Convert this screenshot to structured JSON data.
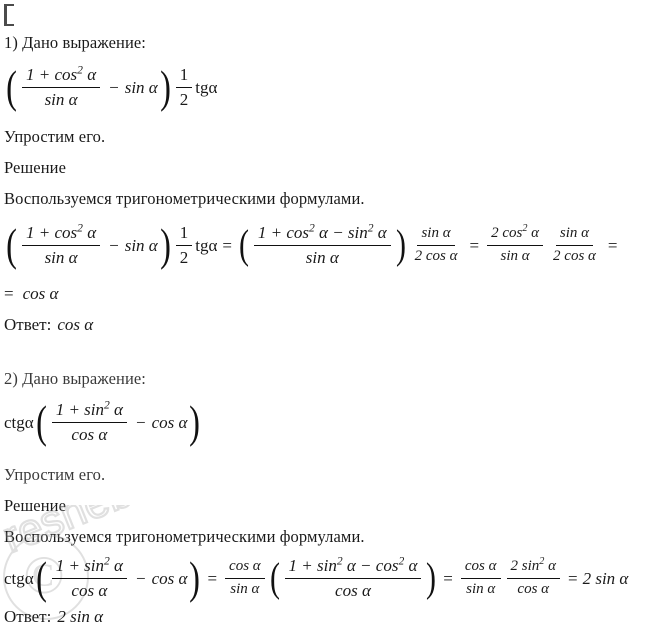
{
  "document": {
    "language": "ru",
    "background_color": "#ffffff",
    "text_color": "#1a1a1a",
    "artifact": {
      "name": "stray-glyph",
      "description": "partial character artifact at top-left corner"
    },
    "watermark": {
      "text": "reshebnik",
      "opacity": 0.3,
      "color": "#9a9a9a"
    }
  },
  "problems": [
    {
      "id": "problem-1",
      "heading": "1) Дано выражение:",
      "expression": {
        "open_paren": "(",
        "fraction": {
          "numerator": "1 + cos² α",
          "denominator": "sin α"
        },
        "minus": "−",
        "subtrahend": "sin α",
        "close_paren": ")",
        "coefficient": {
          "numerator": "1",
          "denominator": "2"
        },
        "factor": "tgα"
      },
      "instruction": "Упростим его.",
      "solution_label": "Решение",
      "method_text": "Воспользуемся тригонометрическими формулами.",
      "derivation": {
        "step1": {
          "open_paren": "(",
          "fraction": {
            "numerator": "1 + cos² α",
            "denominator": "sin α"
          },
          "minus": "−",
          "subtrahend": "sin α",
          "close_paren": ")",
          "coefficient": {
            "numerator": "1",
            "denominator": "2"
          },
          "factor": "tgα"
        },
        "equals1": "=",
        "step2": {
          "open_paren": "(",
          "fraction": {
            "numerator": "1 + cos² α − sin² α",
            "denominator": "sin α"
          },
          "close_paren": ")",
          "multiplier": {
            "numerator": "sin α",
            "denominator": "2 cos α"
          }
        },
        "equals2": "=",
        "step3": {
          "first": {
            "numerator": "2 cos² α",
            "denominator": "sin α"
          },
          "second": {
            "numerator": "sin α",
            "denominator": "2 cos α"
          }
        },
        "equals3": "=",
        "step4": {
          "equals": "=",
          "value": "cos α"
        }
      },
      "answer_label": "Ответ:",
      "answer_value": "cos α"
    },
    {
      "id": "problem-2",
      "heading": "2) Дано выражение:",
      "expression": {
        "prefix": "ctgα",
        "open_paren": "(",
        "fraction": {
          "numerator": "1 + sin² α",
          "denominator": "cos α"
        },
        "minus": "−",
        "subtrahend": "cos α",
        "close_paren": ")"
      },
      "instruction": "Упростим его.",
      "solution_label": "Решение",
      "method_text": "Воспользуемся тригонометрическими формулами.",
      "derivation": {
        "step1": {
          "prefix": "ctgα",
          "open_paren": "(",
          "fraction": {
            "numerator": "1 + sin² α",
            "denominator": "cos α"
          },
          "minus": "−",
          "subtrahend": "cos α",
          "close_paren": ")"
        },
        "equals1": "=",
        "step2": {
          "cot_fraction": {
            "numerator": "cos α",
            "denominator": "sin α"
          },
          "open_paren": "(",
          "fraction": {
            "numerator": "1 + sin² α − cos² α",
            "denominator": "cos α"
          },
          "close_paren": ")"
        },
        "equals2": "=",
        "step3": {
          "first": {
            "numerator": "cos α",
            "denominator": "sin α"
          },
          "second": {
            "numerator": "2 sin² α",
            "denominator": "cos α"
          }
        },
        "equals3": "=",
        "result": "2 sin α"
      },
      "answer_label": "Ответ:",
      "answer_value": "2 sin α"
    }
  ],
  "symbols": {
    "alpha": "α",
    "minus": "−",
    "equals": "=",
    "open_paren": "(",
    "close_paren": ")",
    "superscript_two": "2",
    "one": "1",
    "two": "2",
    "sin": "sin",
    "cos": "cos",
    "tg": "tg",
    "ctg": "ctg",
    "two_cos": "2 cos",
    "two_cos_sq": "2 cos²",
    "two_sin_sq": "2 sin²",
    "one_plus_cos_sq": "1 + cos²",
    "one_plus_sin_sq": "1 + sin²",
    "num_1_cos2_minus_sin2": "1 + cos² α − sin² α",
    "num_1_sin2_minus_cos2": "1 + sin² α − cos² α"
  }
}
